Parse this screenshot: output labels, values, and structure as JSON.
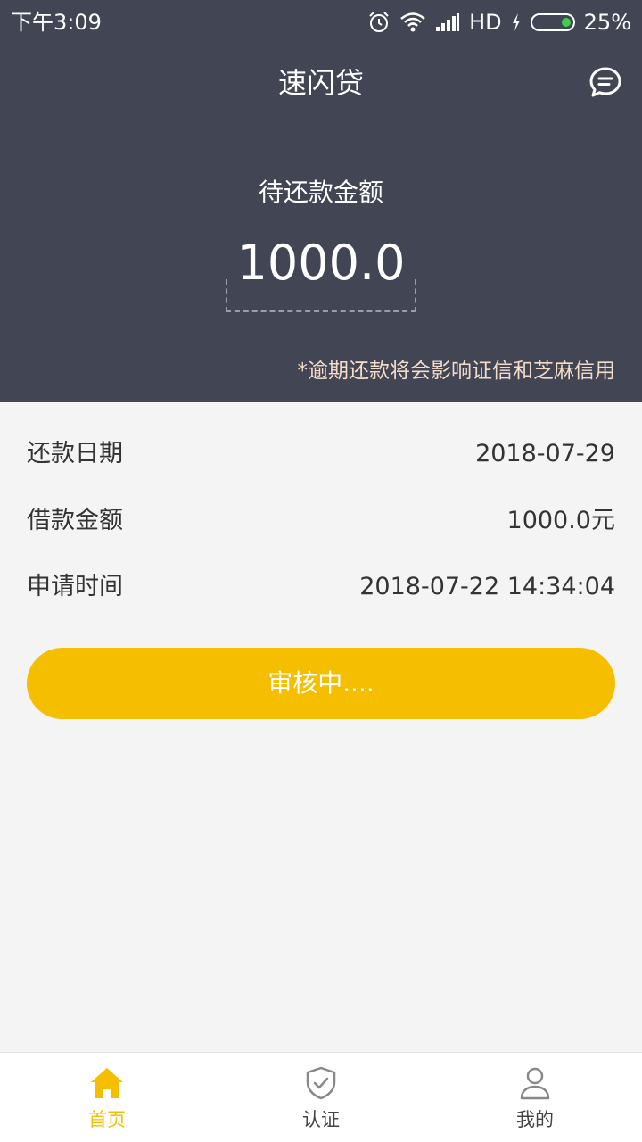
{
  "status_bar": {
    "time": "下午3:09",
    "network": "HD",
    "battery": "25%",
    "battery_level": 0.25,
    "icons": [
      "alarm-icon",
      "wifi-icon",
      "signal-icon",
      "charging-icon",
      "battery-icon"
    ]
  },
  "header": {
    "title": "速闪贷",
    "right_icon": "message-icon",
    "amount_label": "待还款金额",
    "amount_value": "1000.0",
    "overdue_note": "*逾期还款将会影响证信和芝麻信用"
  },
  "details": {
    "rows": [
      {
        "label": "还款日期",
        "value": "2018-07-29"
      },
      {
        "label": "借款金额",
        "value": "1000.0元"
      },
      {
        "label": "申请时间",
        "value": "2018-07-22 14:34:04"
      }
    ]
  },
  "action": {
    "button_label": "审核中...."
  },
  "bottom_nav": {
    "items": [
      {
        "label": "首页",
        "icon": "home-icon",
        "active": true
      },
      {
        "label": "认证",
        "icon": "shield-check-icon",
        "active": false
      },
      {
        "label": "我的",
        "icon": "user-icon",
        "active": false
      }
    ]
  },
  "colors": {
    "header_bg": "#424554",
    "accent": "#f5bf00",
    "page_bg": "#f4f4f4",
    "note_text": "#f3ddc9"
  }
}
